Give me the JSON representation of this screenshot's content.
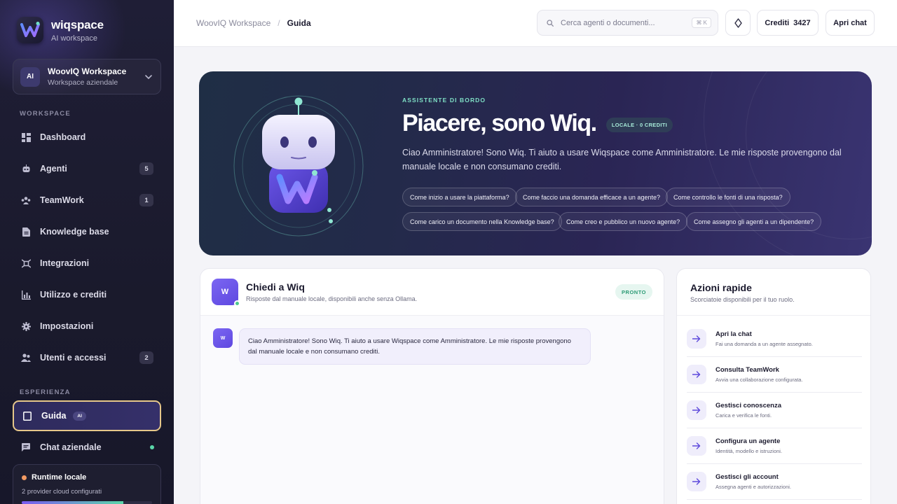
{
  "brand": {
    "name": "wiqspace",
    "subtitle": "AI workspace"
  },
  "workspace": {
    "avatar": "AI",
    "name": "WoovIQ Workspace",
    "type": "Workspace aziendale"
  },
  "sidebar": {
    "section_workspace": "WORKSPACE",
    "section_experience": "ESPERIENZA",
    "items": [
      {
        "label": "Dashboard",
        "icon": "dashboard-icon"
      },
      {
        "label": "Agenti",
        "badge": "5",
        "icon": "robot-icon"
      },
      {
        "label": "TeamWork",
        "badge": "1",
        "icon": "team-icon"
      },
      {
        "label": "Knowledge base",
        "icon": "document-icon"
      },
      {
        "label": "Integrazioni",
        "icon": "integration-icon"
      },
      {
        "label": "Utilizzo e crediti",
        "icon": "bar-chart-icon"
      },
      {
        "label": "Impostazioni",
        "icon": "gear-icon"
      },
      {
        "label": "Utenti e accessi",
        "badge": "2",
        "icon": "users-icon"
      }
    ],
    "experience_items": [
      {
        "label": "Guida",
        "pill": "AI",
        "icon": "book-icon",
        "active": true
      },
      {
        "label": "Chat aziendale",
        "icon": "chat-icon"
      }
    ],
    "runtime": {
      "title": "Runtime locale",
      "subtitle": "2 provider cloud configurati",
      "progress": 0.78
    }
  },
  "topbar": {
    "breadcrumb": [
      "WoovIQ Workspace",
      "/",
      "Guida"
    ],
    "search_placeholder": "Cerca agenti o documenti...",
    "shortcut": "⌘ K",
    "credits_label": "Crediti",
    "credits_value": "3427",
    "open_chat": "Apri chat"
  },
  "hero": {
    "eyebrow": "ASSISTENTE DI BORDO",
    "title": "Piacere, sono Wiq.",
    "badge": "LOCALE · 0 CREDITI",
    "description": "Ciao Amministratore! Sono Wiq. Ti aiuto a usare Wiqspace come Amministratore. Le mie risposte provengono dal manuale locale e non consumano crediti.",
    "chips": [
      "Come inizio a usare la piattaforma?",
      "Come faccio una domanda efficace a un agente?",
      "Come controllo le fonti di una risposta?",
      "Come carico un documento nella Knowledge base?",
      "Come creo e pubblico un nuovo agente?",
      "Come assegno gli agenti a un dipendente?"
    ]
  },
  "chat": {
    "avatar": "W",
    "title": "Chiedi a Wiq",
    "subtitle": "Risposte dal manuale locale, disponibili anche senza Ollama.",
    "status": "PRONTO",
    "message_avatar": "W",
    "message": "Ciao Amministratore! Sono Wiq. Ti aiuto a usare Wiqspace come Amministratore. Le mie risposte provengono dal manuale locale e non consumano crediti."
  },
  "quick_actions": {
    "title": "Azioni rapide",
    "subtitle": "Scorciatoie disponibili per il tuo ruolo.",
    "items": [
      {
        "title": "Apri la chat",
        "subtitle": "Fai una domanda a un agente assegnato."
      },
      {
        "title": "Consulta TeamWork",
        "subtitle": "Avvia una collaborazione configurata."
      },
      {
        "title": "Gestisci conoscenza",
        "subtitle": "Carica e verifica le fonti."
      },
      {
        "title": "Configura un agente",
        "subtitle": "Identità, modello e istruzioni."
      },
      {
        "title": "Gestisci gli account",
        "subtitle": "Assegna agenti e autorizzazioni."
      }
    ]
  },
  "colors": {
    "accent": "#6b55ea",
    "active_border": "#e6c78a",
    "sidebar_bg": "#1f1e36",
    "ready": "#2c9b75"
  }
}
